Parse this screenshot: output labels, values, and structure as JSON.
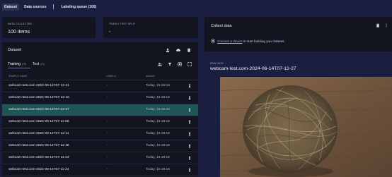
{
  "tabs": [
    {
      "label": "Dataset",
      "active": true
    },
    {
      "label": "Data sources",
      "active": false
    },
    {
      "label": "Labeling queue (100)",
      "active": false
    }
  ],
  "kpi": {
    "collected_label": "DATA COLLECTED",
    "collected_value": "100 items",
    "split_label": "TRAIN / TEST SPLIT",
    "split_value": "-"
  },
  "dataset": {
    "title": "Dataset",
    "header_icons": [
      "person-icon",
      "cloud-upload-icon",
      "trash-icon"
    ],
    "subtabs": [
      {
        "label": "Training",
        "count": "(79)",
        "active": true
      },
      {
        "label": "Test",
        "count": "(21)",
        "active": false
      }
    ],
    "tool_icons": [
      "people-filter-icon",
      "filter-icon",
      "grid-view-icon",
      "expand-icon"
    ],
    "columns": {
      "name": "SAMPLE NAME",
      "labels": "LABELS",
      "added": "ADDED"
    },
    "rows": [
      {
        "name": "webcam-test.com-2024-06-14T07-12-21",
        "labels": "-",
        "added": "Today, 15:19:18"
      },
      {
        "name": "webcam-test.com-2024-06-14T07-12-16",
        "labels": "-",
        "added": "Today, 15:19:18"
      },
      {
        "name": "webcam-test.com-2024-06-14T07-12-27",
        "labels": "-",
        "added": "Today, 15:19:18",
        "selected": true
      },
      {
        "name": "webcam-test.com-2024-06-14T07-11-58",
        "labels": "-",
        "added": "Today, 15:19:18"
      },
      {
        "name": "webcam-test.com-2024-06-14T07-12-11",
        "labels": "-",
        "added": "Today, 15:19:18"
      },
      {
        "name": "webcam-test.com-2024-06-14T07-11-48",
        "labels": "-",
        "added": "Today, 15:19:18"
      },
      {
        "name": "webcam-test.com-2024-06-14T07-11-33",
        "labels": "-",
        "added": "Today, 15:19:18"
      },
      {
        "name": "webcam-test.com-2024-06-14T07-11-24",
        "labels": "-",
        "added": "Today, 15:19:18"
      }
    ]
  },
  "collect": {
    "title": "Collect data",
    "link_text": "Connect a device",
    "rest_text": " to start building your dataset.",
    "icons": [
      "trash-icon",
      "more-vertical-icon"
    ]
  },
  "raw": {
    "label": "RAW DATA",
    "name": "webcam-test.com-2024-06-14T07-12-27"
  },
  "colors": {
    "background": "#1b1f3f",
    "card": "#12151f",
    "selected_row": "#1f5556",
    "link": "#8fb2ff"
  }
}
